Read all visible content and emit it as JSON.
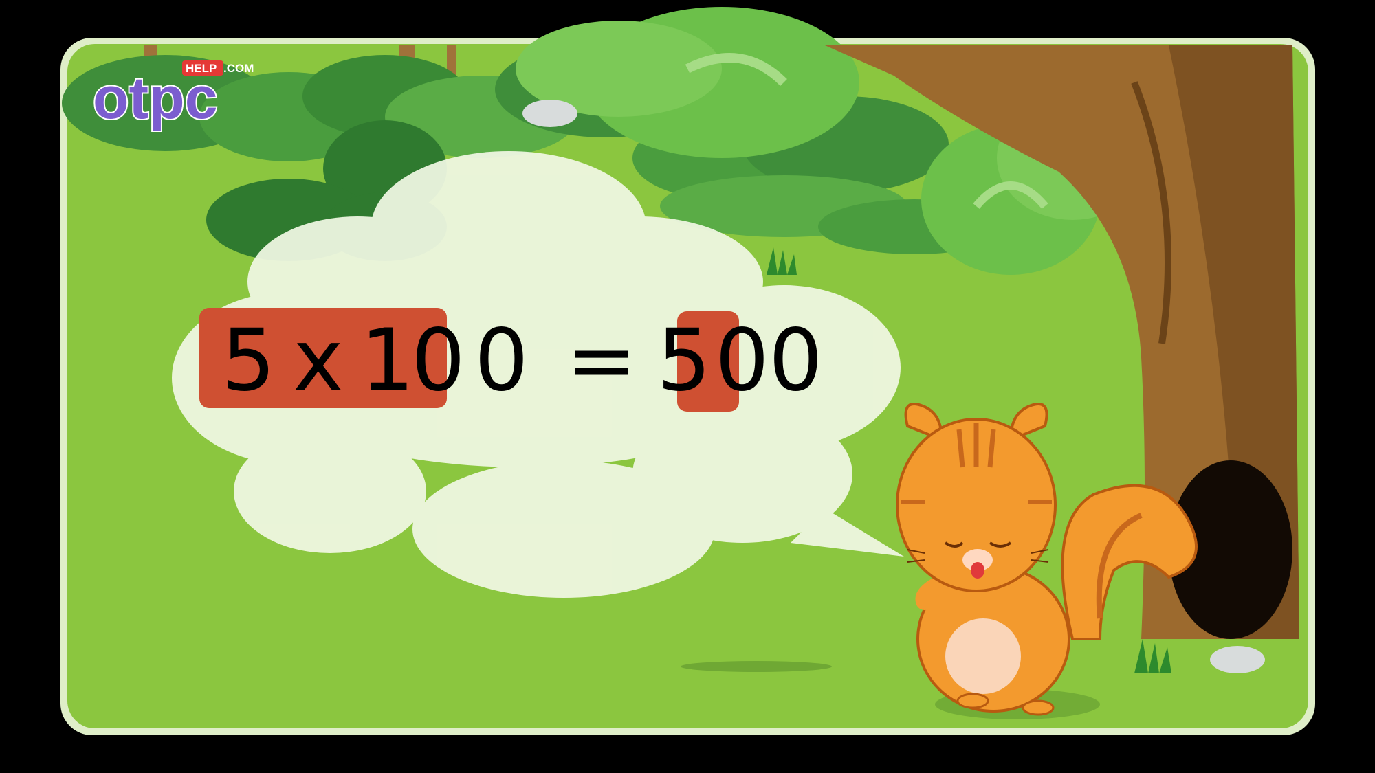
{
  "logo": {
    "brand": "otpc",
    "help_tag": "HELP",
    "domain_tag": ".COM"
  },
  "equation": {
    "factor_a": "5",
    "operator": "x",
    "factor_b_lead": "1",
    "factor_b_rest_1": "0",
    "factor_b_rest_2": "0",
    "equals": "=",
    "result_lead": "5",
    "result_rest_1": "0",
    "result_rest_2": "0"
  },
  "colors": {
    "frame": "#000000",
    "grass": "#8bc63f",
    "bubble": "#f1f8e4",
    "highlight": "#cf5032",
    "squirrel": "#f39a2e"
  },
  "icons": [
    "speech-bubble",
    "squirrel-character",
    "tree",
    "bushes",
    "rock"
  ]
}
